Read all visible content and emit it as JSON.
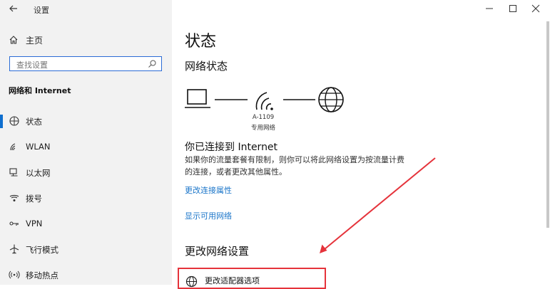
{
  "window": {
    "title": "设置"
  },
  "sidebar": {
    "home_label": "主页",
    "search_placeholder": "查找设置",
    "section_title": "网络和 Internet",
    "items": [
      {
        "label": "状态",
        "icon": "status-icon",
        "active": true
      },
      {
        "label": "WLAN",
        "icon": "wifi-icon"
      },
      {
        "label": "以太网",
        "icon": "ethernet-icon"
      },
      {
        "label": "拨号",
        "icon": "dialup-icon"
      },
      {
        "label": "VPN",
        "icon": "vpn-icon"
      },
      {
        "label": "飞行模式",
        "icon": "airplane-icon"
      },
      {
        "label": "移动热点",
        "icon": "hotspot-icon"
      }
    ]
  },
  "main": {
    "page_title": "状态",
    "network_status_title": "网络状态",
    "network_name": "A-1109",
    "network_type": "专用网络",
    "connected_title": "你已连接到 Internet",
    "connected_desc": "如果你的流量套餐有限制，则你可以将此网络设置为按流量计费的连接，或者更改其他属性。",
    "link_change_properties": "更改连接属性",
    "link_show_networks": "显示可用网络",
    "change_settings_title": "更改网络设置",
    "adapter_option_label": "更改适配器选项"
  },
  "colors": {
    "accent": "#0f6fcf",
    "link": "#1a75c9",
    "annotation": "#e5333b"
  }
}
